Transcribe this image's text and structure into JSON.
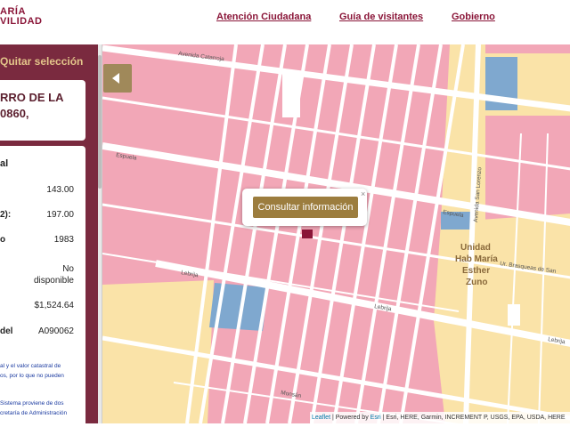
{
  "header": {
    "logo_line1": "ARÍA",
    "logo_line2": "VILIDAD",
    "nav": [
      "Atención Ciudadana",
      "Guía de visitantes",
      "Gobierno"
    ]
  },
  "sidebar": {
    "clear_selection": "Quitar selección",
    "title_line1": "RRO DE LA",
    "title_line2": "0860,",
    "section_title": "al",
    "rows": [
      {
        "label": "",
        "value": "143.00"
      },
      {
        "label": "2):",
        "value": "197.00"
      },
      {
        "label": "o",
        "value": "1983"
      },
      {
        "label": "",
        "value_line1": "No",
        "value_line2": "disponible"
      },
      {
        "label": "",
        "value": "$1,524.64"
      },
      {
        "label": "del",
        "value": "A090062"
      }
    ],
    "note1_line1": "al y el valor catastral de",
    "note1_line2": "os, por lo que no pueden",
    "note2_line1": "Sistema proviene de dos",
    "note2_line2": "cretaría de Administración"
  },
  "map": {
    "popup_button": "Consultar información",
    "popup_close": "×",
    "attribution_leaflet": "Leaflet",
    "attribution_sep": " | Powered by ",
    "attribution_esri": "Esri",
    "attribution_rest": " | Esri, HERE, Garmin, INCREMENT P, USGS, EPA, USDA, HERE",
    "area_label": [
      "Unidad",
      "Hab María",
      "Esther",
      "Zuno"
    ],
    "streets": [
      "Avenida Catarroja",
      "Espuela",
      "Lebrija",
      "Espuela",
      "Avenida San Lorenzo",
      "Lebrija",
      "Lebrija",
      "Monsán",
      "Ur. Brasqueas de San"
    ],
    "colors": {
      "residential": "#f2a7b7",
      "commercial": "#fae3a8",
      "government": "#7fa8cf",
      "road": "#ffffff",
      "brand": "#8a1538",
      "gold": "#9c7d3e"
    }
  }
}
